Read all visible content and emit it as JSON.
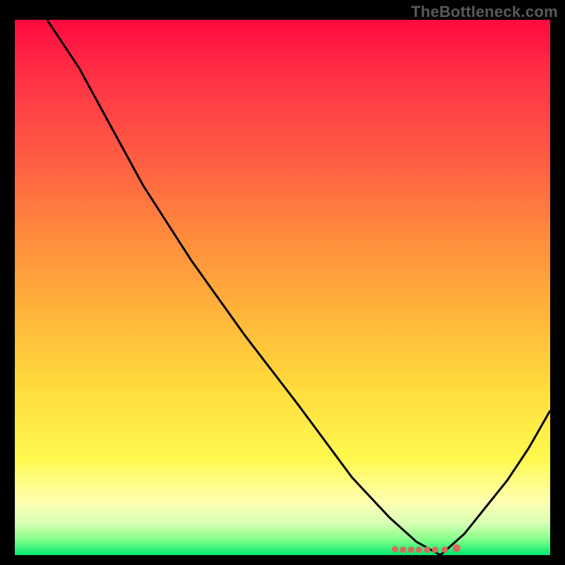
{
  "watermark": "TheBottleneck.com",
  "chart_data": {
    "type": "line",
    "title": "",
    "xlabel": "",
    "ylabel": "",
    "xlim": [
      0,
      100
    ],
    "ylim": [
      0,
      100
    ],
    "series": [
      {
        "name": "bottleneck-curve",
        "x": [
          6,
          12,
          18,
          24,
          33,
          43,
          53,
          63,
          70,
          75,
          79.5,
          84,
          88,
          92,
          96,
          100
        ],
        "values": [
          100,
          91,
          80,
          69,
          55,
          41,
          28,
          14.5,
          7,
          2.5,
          0,
          4,
          9,
          14,
          20,
          27
        ]
      }
    ],
    "markers": {
      "name": "optimal-region",
      "x": [
        71,
        72.5,
        74,
        75.5,
        77,
        78.5,
        80.3,
        82.5
      ],
      "values": [
        1.1,
        1.0,
        1.0,
        1.0,
        1.0,
        1.0,
        1.0,
        1.3
      ]
    },
    "gradient_stops": [
      {
        "pos": 0,
        "color": "#ff0a3f"
      },
      {
        "pos": 25,
        "color": "#ff5a44"
      },
      {
        "pos": 55,
        "color": "#ffb53a"
      },
      {
        "pos": 82,
        "color": "#fff94f"
      },
      {
        "pos": 94,
        "color": "#d9ffb5"
      },
      {
        "pos": 100,
        "color": "#00e872"
      }
    ]
  }
}
